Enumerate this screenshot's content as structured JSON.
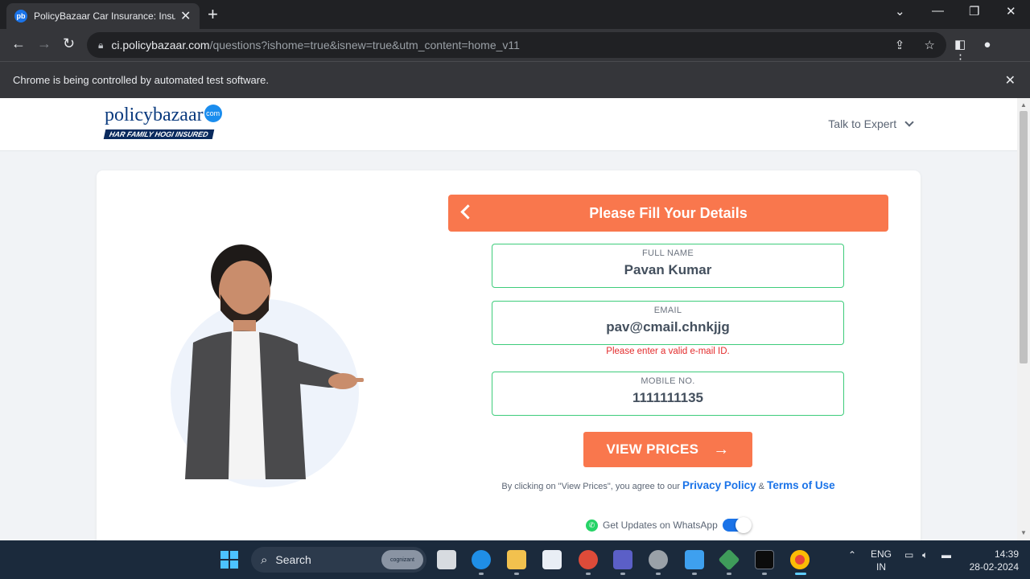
{
  "browser": {
    "tab_title": "PolicyBazaar Car Insurance: Insu",
    "tab_favicon": "pb",
    "url_host": "ci.policybazaar.com",
    "url_path": "/questions?ishome=true&isnew=true&utm_content=home_v11",
    "infobar_text": "Chrome is being controlled by automated test software."
  },
  "header": {
    "logo_main": "policybazaar",
    "logo_badge": "com",
    "logo_tagline": "HAR FAMILY HOGI INSURED",
    "talk_expert": "Talk to Expert"
  },
  "form": {
    "title": "Please Fill Your Details",
    "full_name_label": "FULL NAME",
    "full_name_value": "Pavan Kumar",
    "email_label": "EMAIL",
    "email_value": "pav@cmail.chnkjjg",
    "email_error": "Please enter a valid e-mail ID.",
    "mobile_label": "MOBILE NO.",
    "mobile_value": "1111111135",
    "cta_label": "VIEW PRICES",
    "terms_prefix": "By clicking on \"View Prices\", you agree to our",
    "privacy_link": "Privacy Policy",
    "terms_amp": "&",
    "terms_link": "Terms of Use",
    "whatsapp_label": "Get Updates on WhatsApp",
    "whatsapp_enabled": true
  },
  "taskbar": {
    "search_label": "Search",
    "search_pill": "cognizant",
    "lang_top": "ENG",
    "lang_bottom": "IN",
    "time": "14:39",
    "date": "28-02-2024"
  },
  "colors": {
    "accent_orange": "#f9774d",
    "success_green": "#3ecc7b",
    "error_red": "#e32c2c",
    "link_blue": "#1a73e8",
    "brand_navy": "#0a3a7e"
  }
}
